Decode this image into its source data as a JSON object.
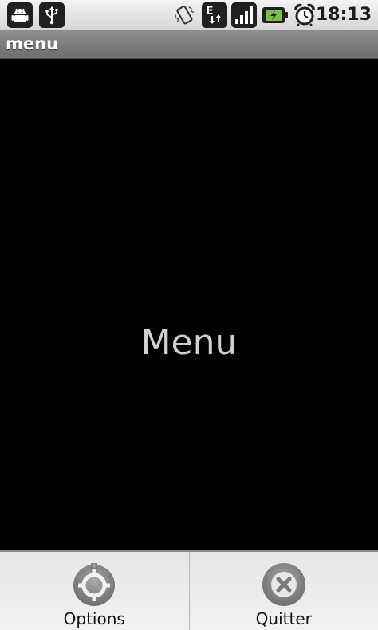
{
  "status_bar": {
    "time": "18:13",
    "icons": [
      "android-debug-icon",
      "usb-icon",
      "vibrate-icon",
      "edge-data-icon",
      "signal-icon",
      "battery-charging-icon",
      "alarm-icon"
    ],
    "network_letter": "E"
  },
  "title_bar": {
    "title": "menu"
  },
  "content": {
    "text": "Menu"
  },
  "options_menu": {
    "items": [
      {
        "label": "Options",
        "icon": "settings-icon"
      },
      {
        "label": "Quitter",
        "icon": "close-icon"
      }
    ]
  },
  "colors": {
    "status_bar": "#dcdcdc",
    "title_bar": "#7a7a7a",
    "background": "#000000",
    "center_text": "#cfcfcf",
    "menu_background": "#ececec",
    "battery_accent": "#7ac143"
  }
}
